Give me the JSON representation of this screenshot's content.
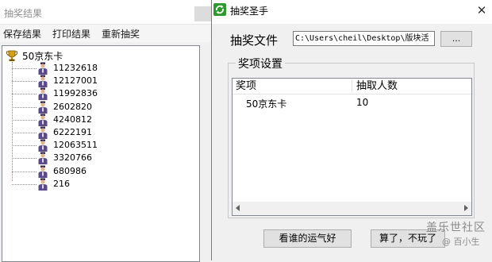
{
  "left_window": {
    "title": "抽奖结果",
    "menu": [
      "保存结果",
      "打印结果",
      "重新抽奖"
    ],
    "tree": {
      "root_icon": "trophy-icon",
      "root_label": "50京东卡",
      "item_icon": "person-icon",
      "items": [
        "11232618",
        "12127001",
        "11992836",
        "2602820",
        "4240812",
        "6222191",
        "12063511",
        "3320766",
        "680986",
        "216"
      ]
    }
  },
  "right_window": {
    "app_icon": "recycle-arrows-icon",
    "title": "抽奖圣手",
    "close_glyph": "✕",
    "file_label": "抽奖文件",
    "file_path": "C:\\Users\\cheil\\Desktop\\版块活",
    "browse_label": "...",
    "group_title": "奖项设置",
    "list": {
      "columns": [
        "奖项",
        "抽取人数"
      ],
      "rows": [
        [
          "50京东卡",
          "10"
        ]
      ]
    },
    "luck_button": "看谁的运气好",
    "quit_button": "算了，不玩了"
  },
  "watermark": {
    "line1": "盖乐世社区",
    "line2": "@ 百小生"
  },
  "colors": {
    "window_bg": "#f0f0f0",
    "titlebar_bg": "#ffffff",
    "button_bg": "#e1e1e1",
    "tree_line": "#8a8a8a"
  }
}
